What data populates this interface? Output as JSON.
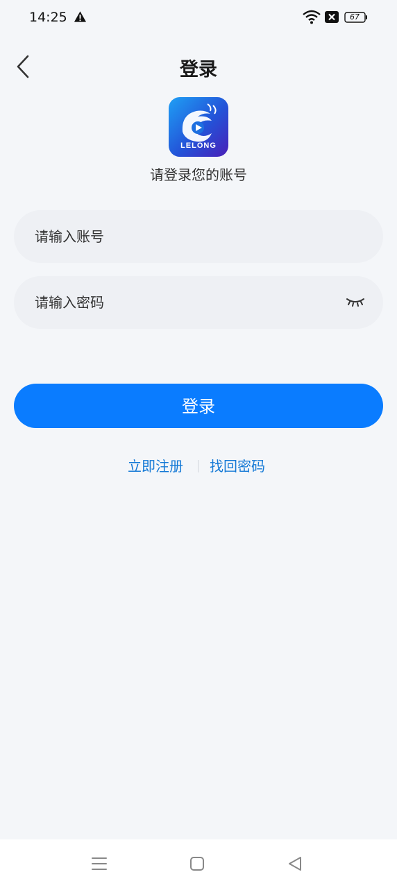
{
  "status_bar": {
    "time": "14:25",
    "battery": "67"
  },
  "header": {
    "title": "登录"
  },
  "logo": {
    "text": "LELONG"
  },
  "subtitle": "请登录您的账号",
  "form": {
    "account_placeholder": "请输入账号",
    "password_placeholder": "请输入密码",
    "login_label": "登录"
  },
  "links": {
    "register": "立即注册",
    "recover": "找回密码"
  },
  "colors": {
    "primary": "#0a7cff",
    "link": "#1479d6",
    "background": "#f4f6f9",
    "input": "#eef0f4"
  },
  "icons": [
    "warning-icon",
    "wifi-icon",
    "close-box-icon",
    "battery-icon",
    "back-arrow-icon",
    "eye-closed-icon",
    "menu-icon",
    "home-icon",
    "back-triangle-icon"
  ]
}
